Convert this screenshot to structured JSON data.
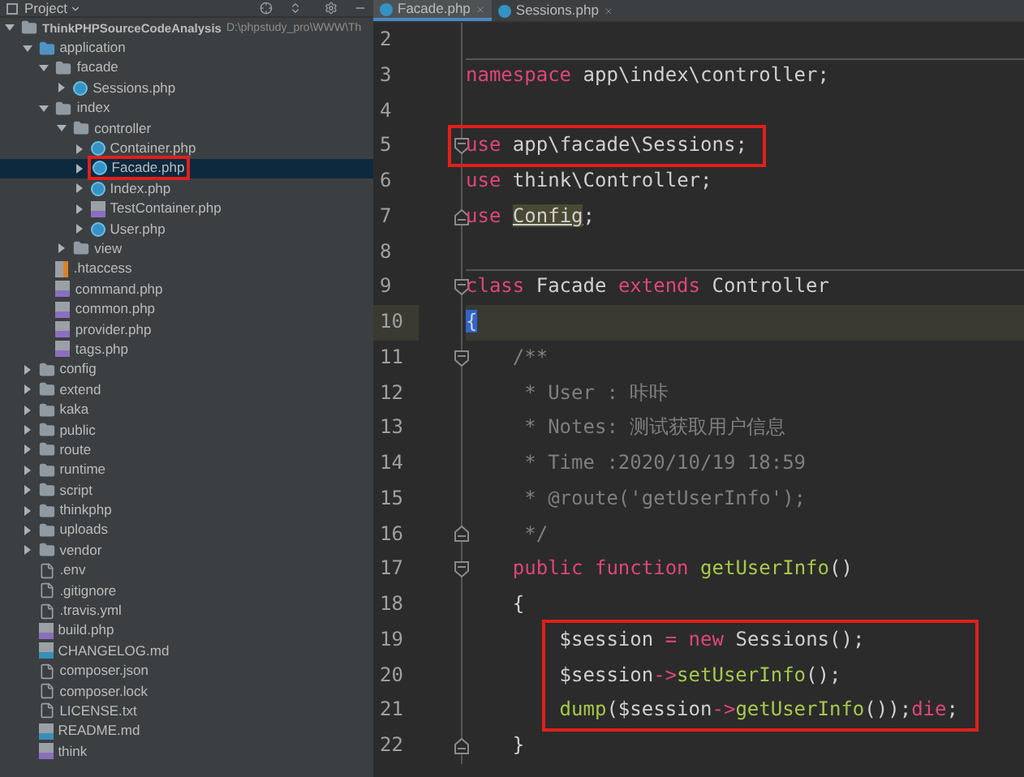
{
  "project_panel": {
    "title": "Project",
    "tree": [
      {
        "name": "ThinkPHPSourceCodeAnalysis",
        "path": "D:\\phpstudy_pro\\WWW\\Th",
        "kind": "folder",
        "expanded": true,
        "selected": false,
        "children": [
          {
            "name": "application",
            "kind": "source-folder",
            "expanded": true,
            "selected": false,
            "children": [
              {
                "name": "facade",
                "kind": "folder",
                "expanded": true,
                "selected": false,
                "children": [
                  {
                    "name": "Sessions.php",
                    "kind": "class",
                    "expanded": false,
                    "selected": false
                  }
                ]
              },
              {
                "name": "index",
                "kind": "folder",
                "expanded": true,
                "selected": false,
                "children": [
                  {
                    "name": "controller",
                    "kind": "folder",
                    "expanded": true,
                    "selected": false,
                    "children": [
                      {
                        "name": "Container.php",
                        "kind": "class",
                        "expanded": false,
                        "selected": false
                      },
                      {
                        "name": "Facade.php",
                        "kind": "class",
                        "expanded": false,
                        "selected": true,
                        "boxed": true
                      },
                      {
                        "name": "Index.php",
                        "kind": "class",
                        "expanded": false,
                        "selected": false
                      },
                      {
                        "name": "TestContainer.php",
                        "kind": "php",
                        "expanded": false,
                        "selected": false
                      },
                      {
                        "name": "User.php",
                        "kind": "class",
                        "expanded": false,
                        "selected": false
                      }
                    ]
                  },
                  {
                    "name": "view",
                    "kind": "folder",
                    "expanded": false,
                    "selected": false
                  }
                ]
              },
              {
                "name": ".htaccess",
                "kind": "htaccess",
                "selected": false
              },
              {
                "name": "command.php",
                "kind": "php",
                "selected": false
              },
              {
                "name": "common.php",
                "kind": "php",
                "selected": false
              },
              {
                "name": "provider.php",
                "kind": "php",
                "selected": false
              },
              {
                "name": "tags.php",
                "kind": "php",
                "selected": false
              }
            ]
          },
          {
            "name": "config",
            "kind": "folder",
            "expanded": false,
            "selected": false
          },
          {
            "name": "extend",
            "kind": "folder",
            "expanded": false,
            "selected": false
          },
          {
            "name": "kaka",
            "kind": "folder",
            "expanded": false,
            "selected": false
          },
          {
            "name": "public",
            "kind": "folder",
            "expanded": false,
            "selected": false
          },
          {
            "name": "route",
            "kind": "folder",
            "expanded": false,
            "selected": false
          },
          {
            "name": "runtime",
            "kind": "folder",
            "expanded": false,
            "selected": false
          },
          {
            "name": "script",
            "kind": "folder",
            "expanded": false,
            "selected": false
          },
          {
            "name": "thinkphp",
            "kind": "folder",
            "expanded": false,
            "selected": false
          },
          {
            "name": "uploads",
            "kind": "folder",
            "expanded": false,
            "selected": false
          },
          {
            "name": "vendor",
            "kind": "folder",
            "expanded": false,
            "selected": false
          },
          {
            "name": ".env",
            "kind": "text",
            "selected": false
          },
          {
            "name": ".gitignore",
            "kind": "text",
            "selected": false
          },
          {
            "name": ".travis.yml",
            "kind": "text",
            "selected": false
          },
          {
            "name": "build.php",
            "kind": "php",
            "selected": false
          },
          {
            "name": "CHANGELOG.md",
            "kind": "markdown",
            "selected": false
          },
          {
            "name": "composer.json",
            "kind": "text",
            "selected": false
          },
          {
            "name": "composer.lock",
            "kind": "text",
            "selected": false
          },
          {
            "name": "LICENSE.txt",
            "kind": "text",
            "selected": false
          },
          {
            "name": "README.md",
            "kind": "markdown",
            "selected": false
          },
          {
            "name": "think",
            "kind": "php",
            "selected": false
          }
        ]
      }
    ]
  },
  "editor": {
    "tabs": [
      {
        "label": "Facade.php",
        "selected": true
      },
      {
        "label": "Sessions.php",
        "selected": false
      }
    ],
    "lines": [
      {
        "number": "2",
        "current": false,
        "separator": false,
        "boxed": false,
        "fold_start": false,
        "fold_end": false
      },
      {
        "number": "3",
        "current": false,
        "separator": true,
        "boxed": false,
        "fold_start": false,
        "fold_end": false,
        "tokens": [
          {
            "kind": "keyword",
            "text": "namespace"
          },
          {
            "kind": "plain",
            "text": " app\\index\\controller;"
          }
        ]
      },
      {
        "number": "4",
        "current": false,
        "separator": false,
        "boxed": false,
        "fold_start": false,
        "fold_end": false
      },
      {
        "number": "5",
        "current": false,
        "separator": false,
        "boxed": true,
        "fold_start": true,
        "fold_end": false,
        "tokens": [
          {
            "kind": "keyword",
            "text": "use"
          },
          {
            "kind": "plain",
            "text": " app\\facade\\Sessions;"
          }
        ]
      },
      {
        "number": "6",
        "current": false,
        "separator": false,
        "boxed": false,
        "fold_start": false,
        "fold_end": false,
        "tokens": [
          {
            "kind": "keyword",
            "text": "use"
          },
          {
            "kind": "plain",
            "text": " think\\Controller;"
          }
        ]
      },
      {
        "number": "7",
        "current": false,
        "separator": false,
        "boxed": false,
        "fold_start": false,
        "fold_end": true,
        "tokens": [
          {
            "kind": "keyword",
            "text": "use"
          },
          {
            "kind": "unused",
            "text": " Config"
          },
          {
            "kind": "plain",
            "text": ";"
          }
        ]
      },
      {
        "number": "8",
        "current": false,
        "separator": false,
        "boxed": false,
        "fold_start": false,
        "fold_end": false
      },
      {
        "number": "9",
        "current": false,
        "separator": true,
        "boxed": false,
        "fold_start": true,
        "fold_end": false,
        "tokens": [
          {
            "kind": "keyword",
            "text": "class"
          },
          {
            "kind": "plain",
            "text": " Facade "
          },
          {
            "kind": "keyword",
            "text": "extends"
          },
          {
            "kind": "plain",
            "text": " Controller"
          }
        ]
      },
      {
        "number": "10",
        "current": true,
        "separator": false,
        "boxed": false,
        "fold_start": false,
        "fold_end": false,
        "tokens": [
          {
            "kind": "brace",
            "text": "{"
          }
        ]
      },
      {
        "number": "11",
        "current": false,
        "separator": false,
        "boxed": false,
        "fold_start": true,
        "fold_end": false,
        "tokens": [
          {
            "kind": "comment",
            "text": "    /**"
          }
        ]
      },
      {
        "number": "12",
        "current": false,
        "separator": false,
        "boxed": false,
        "fold_start": false,
        "fold_end": false,
        "tokens": [
          {
            "kind": "comment",
            "text": "     * User : 咔咔"
          }
        ]
      },
      {
        "number": "13",
        "current": false,
        "separator": false,
        "boxed": false,
        "fold_start": false,
        "fold_end": false,
        "tokens": [
          {
            "kind": "comment",
            "text": "     * Notes: 测试获取用户信息"
          }
        ]
      },
      {
        "number": "14",
        "current": false,
        "separator": false,
        "boxed": false,
        "fold_start": false,
        "fold_end": false,
        "tokens": [
          {
            "kind": "comment",
            "text": "     * Time :2020/10/19 18:59"
          }
        ]
      },
      {
        "number": "15",
        "current": false,
        "separator": false,
        "boxed": false,
        "fold_start": false,
        "fold_end": false,
        "tokens": [
          {
            "kind": "comment",
            "text": "     * @route('getUserInfo');"
          }
        ]
      },
      {
        "number": "16",
        "current": false,
        "separator": false,
        "boxed": false,
        "fold_start": false,
        "fold_end": true,
        "tokens": [
          {
            "kind": "comment",
            "text": "     */"
          }
        ]
      },
      {
        "number": "17",
        "current": false,
        "separator": false,
        "boxed": false,
        "fold_start": true,
        "fold_end": false,
        "tokens": [
          {
            "kind": "keyword",
            "text": "    public function"
          },
          {
            "kind": "function",
            "text": " getUserInfo"
          },
          {
            "kind": "plain",
            "text": "()"
          }
        ]
      },
      {
        "number": "18",
        "current": false,
        "separator": false,
        "boxed": false,
        "fold_start": false,
        "fold_end": false,
        "tokens": [
          {
            "kind": "plain",
            "text": "    {"
          }
        ]
      },
      {
        "number": "19",
        "current": false,
        "separator": false,
        "boxed": true,
        "fold_start": false,
        "fold_end": false,
        "tokens": [
          {
            "kind": "plain",
            "text": "        $session"
          },
          {
            "kind": "operator",
            "text": " ="
          },
          {
            "kind": "keyword",
            "text": " new"
          },
          {
            "kind": "plain",
            "text": " Sessions();"
          }
        ]
      },
      {
        "number": "20",
        "current": false,
        "separator": false,
        "boxed": true,
        "fold_start": false,
        "fold_end": false,
        "tokens": [
          {
            "kind": "plain",
            "text": "        $session"
          },
          {
            "kind": "operator",
            "text": "->"
          },
          {
            "kind": "function",
            "text": "setUserInfo"
          },
          {
            "kind": "plain",
            "text": "();"
          }
        ]
      },
      {
        "number": "21",
        "current": false,
        "separator": false,
        "boxed": true,
        "fold_start": false,
        "fold_end": false,
        "tokens": [
          {
            "kind": "function",
            "text": "        dump"
          },
          {
            "kind": "plain",
            "text": "($session"
          },
          {
            "kind": "operator",
            "text": "->"
          },
          {
            "kind": "function",
            "text": "getUserInfo"
          },
          {
            "kind": "plain",
            "text": "());"
          },
          {
            "kind": "keyword",
            "text": "die"
          },
          {
            "kind": "plain",
            "text": ";"
          }
        ]
      },
      {
        "number": "22",
        "current": false,
        "separator": false,
        "boxed": false,
        "fold_start": false,
        "fold_end": true,
        "tokens": [
          {
            "kind": "plain",
            "text": "    }"
          }
        ]
      }
    ]
  }
}
